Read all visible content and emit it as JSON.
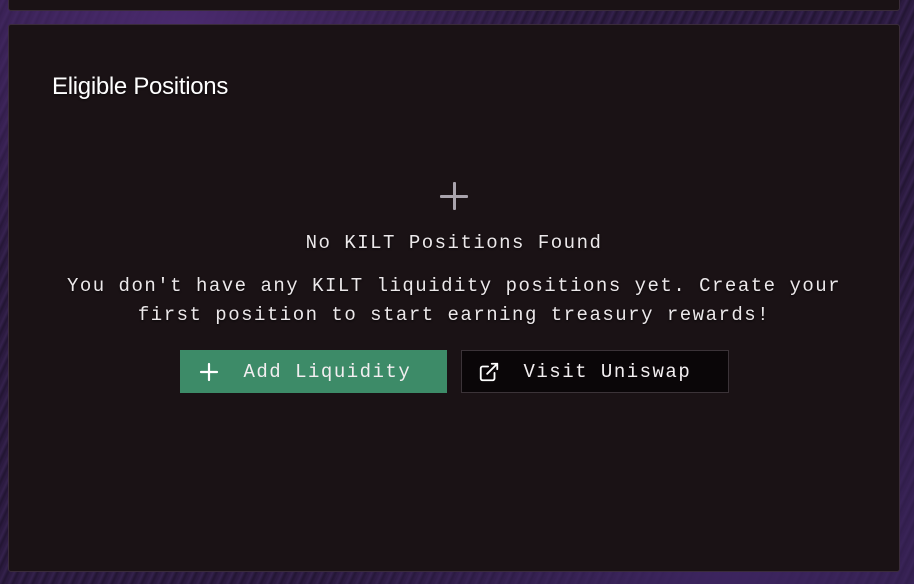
{
  "section": {
    "title": "Eligible Positions"
  },
  "empty_state": {
    "icon": "plus-icon",
    "heading": "No KILT Positions Found",
    "description": "You don't have any KILT liquidity positions yet. Create your first position to start earning treasury rewards!"
  },
  "actions": {
    "add_liquidity": {
      "label": "Add Liquidity",
      "icon": "plus-icon"
    },
    "visit_uniswap": {
      "label": "Visit Uniswap",
      "icon": "external-link-icon"
    }
  },
  "colors": {
    "card_bg": "#1a1215",
    "primary_button": "#3d8b68",
    "secondary_button": "#0a0608",
    "text": "#ece8ea"
  }
}
